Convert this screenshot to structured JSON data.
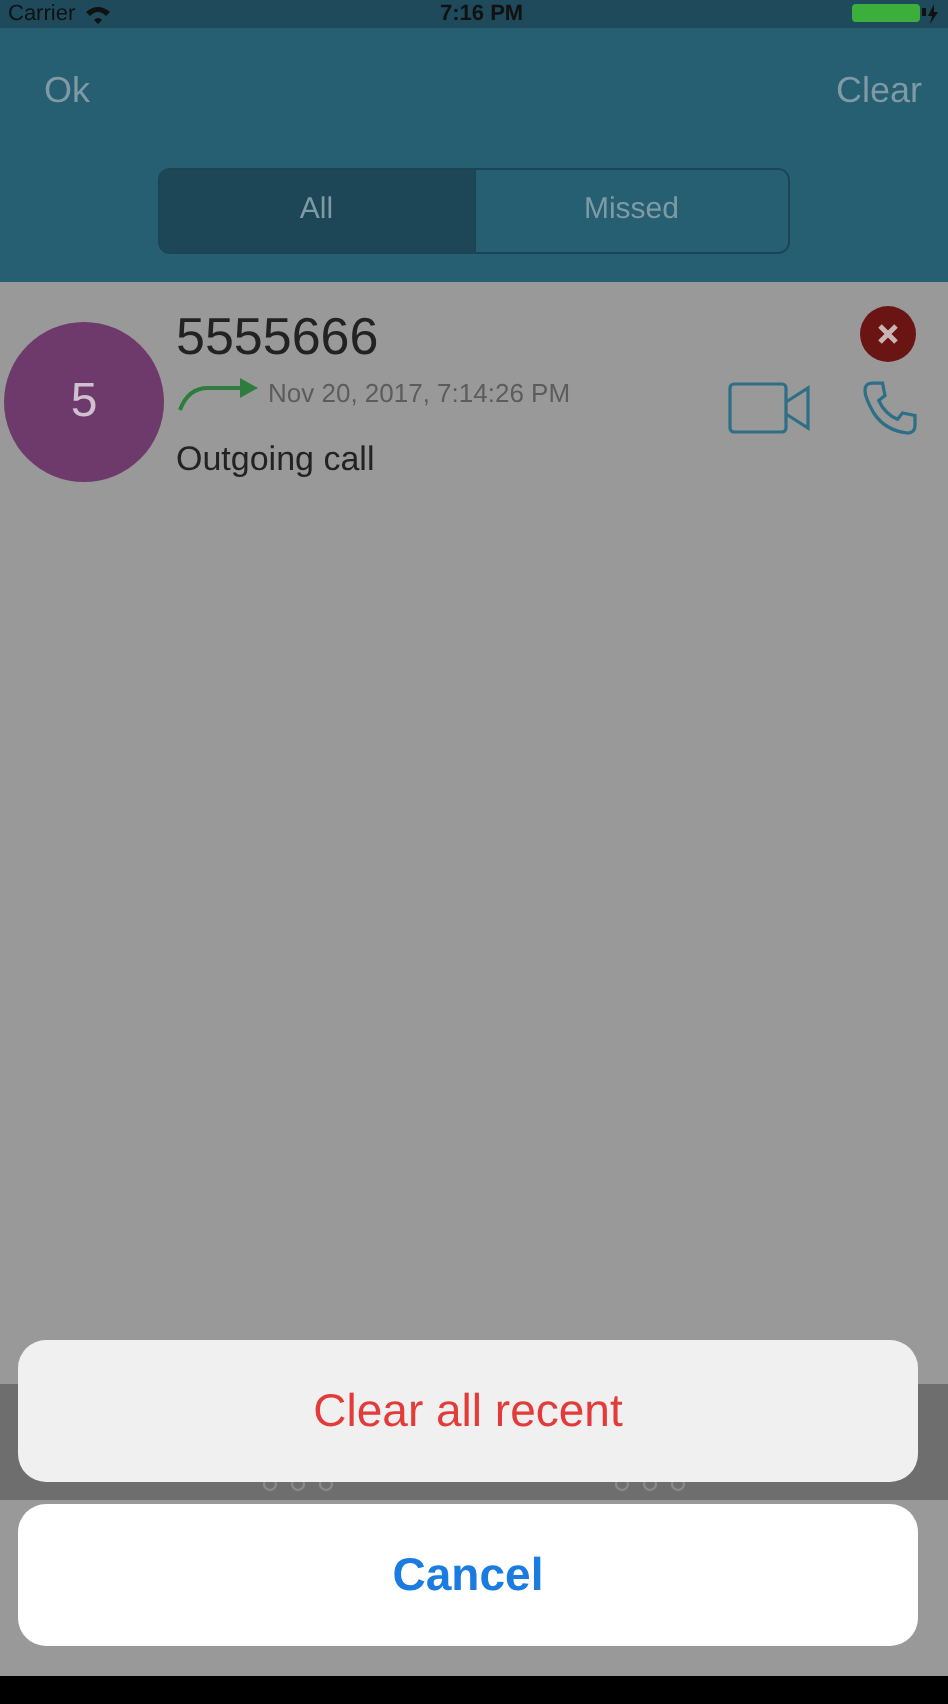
{
  "status_bar": {
    "carrier": "Carrier",
    "time": "7:16 PM"
  },
  "header": {
    "left_button": "Ok",
    "right_button": "Clear"
  },
  "tabs": [
    {
      "label": "All",
      "selected": true
    },
    {
      "label": "Missed",
      "selected": false
    }
  ],
  "calls": [
    {
      "avatar_letter": "5",
      "color": "#6e3a6b",
      "number": "5555666",
      "kind": "outgoing",
      "timestamp": "Nov 20, 2017, 7:14:26 PM",
      "description": "Outgoing call"
    }
  ],
  "action_sheet": {
    "actions": [
      {
        "label": "Clear all recent",
        "kind": "destructive"
      },
      {
        "label": "Cancel",
        "kind": "cancel"
      }
    ]
  }
}
